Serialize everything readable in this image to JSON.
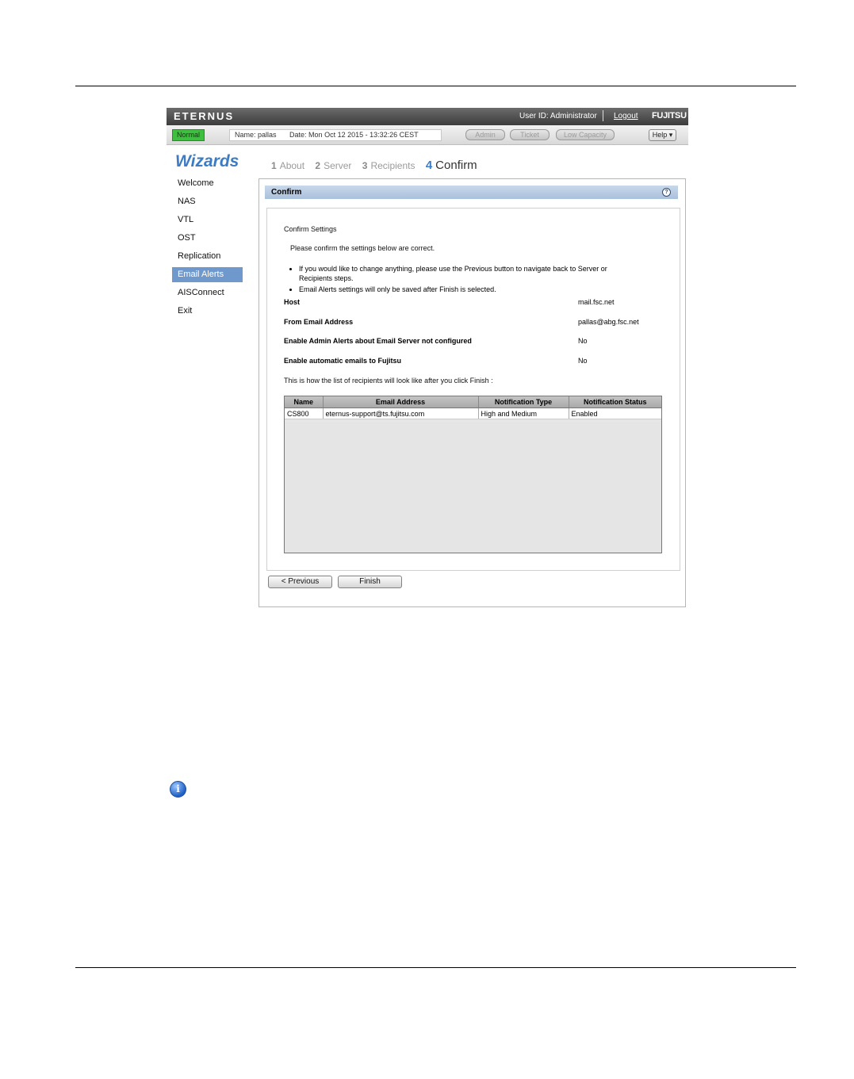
{
  "header": {
    "brand": "ETERNUS",
    "user_id": "User ID: Administrator",
    "logout": "Logout",
    "vendor": "FUJITSU"
  },
  "statusbar": {
    "status": "Normal",
    "name": "Name: pallas",
    "date": "Date: Mon Oct 12 2015 - 13:32:26 CEST",
    "buttons": [
      "Admin",
      "Ticket",
      "Low Capacity"
    ],
    "help": "Help ▾"
  },
  "wizard": {
    "title": "Wizards",
    "steps": [
      {
        "num": "1",
        "label": "About"
      },
      {
        "num": "2",
        "label": "Server"
      },
      {
        "num": "3",
        "label": "Recipients"
      },
      {
        "num": "4",
        "label": "Confirm"
      }
    ]
  },
  "sidebar": {
    "items": [
      "Welcome",
      "NAS",
      "VTL",
      "OST",
      "Replication",
      "Email Alerts",
      "AISConnect",
      "Exit"
    ],
    "selected": "Email Alerts"
  },
  "panel": {
    "title": "Confirm",
    "section": "Confirm Settings",
    "intro": "Please confirm the settings below are correct.",
    "notes": [
      "If you would like to change anything, please use the Previous button to navigate back to Server or Recipients steps.",
      "Email Alerts settings will only be saved after Finish is selected."
    ],
    "settings": [
      {
        "label": "Host",
        "value": "mail.fsc.net"
      },
      {
        "label": "From Email Address",
        "value": "pallas@abg.fsc.net"
      },
      {
        "label": "Enable Admin Alerts about Email Server not configured",
        "value": "No"
      },
      {
        "label": "Enable automatic emails to Fujitsu",
        "value": "No"
      }
    ],
    "recipients_caption": "This is how the list of recipients will look like after you click Finish :",
    "table": {
      "headers": [
        "Name",
        "Email Address",
        "Notification Type",
        "Notification Status"
      ],
      "rows": [
        [
          "CS800",
          "eternus-support@ts.fujitsu.com",
          "High and Medium",
          "Enabled"
        ]
      ]
    },
    "buttons": {
      "previous": "< Previous",
      "finish": "Finish"
    }
  }
}
